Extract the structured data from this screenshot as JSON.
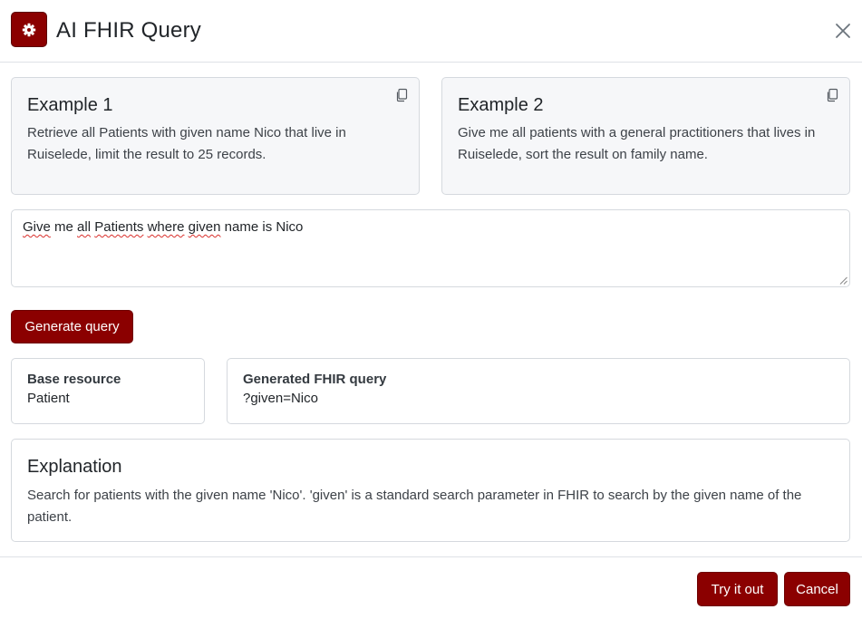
{
  "header": {
    "app_icon": "gear-icon",
    "title": "AI FHIR Query",
    "close_icon": "close-icon"
  },
  "examples": [
    {
      "title": "Example 1",
      "text": "Retrieve all Patients with given name Nico that live in Ruiselede, limit the result to 25 records.",
      "icon": "copy-icon"
    },
    {
      "title": "Example 2",
      "text": "Give me all patients with a general practitioners that lives in Ruiselede, sort the result on family name.",
      "icon": "copy-icon"
    }
  ],
  "prompt": {
    "words": [
      "Give",
      "me",
      "all",
      "Patients",
      "where",
      "given",
      "name",
      "is",
      "Nico"
    ],
    "misspelled_flags": [
      true,
      false,
      true,
      true,
      true,
      true,
      false,
      false,
      false
    ]
  },
  "generate_button": {
    "label": "Generate query"
  },
  "result": {
    "base_resource": {
      "label": "Base resource",
      "value": "Patient"
    },
    "generated_query": {
      "label": "Generated FHIR query",
      "value": "?given=Nico"
    }
  },
  "explanation": {
    "title": "Explanation",
    "text": "Search for patients with the given name 'Nico'. 'given' is a standard search parameter in FHIR to search by the given name of the patient."
  },
  "footer": {
    "try_label": "Try it out",
    "cancel_label": "Cancel"
  },
  "colors": {
    "accent": "#8b0000",
    "card_bg": "#f6f7f9",
    "border": "#d5d9de",
    "spellcheck": "#d9302c"
  }
}
